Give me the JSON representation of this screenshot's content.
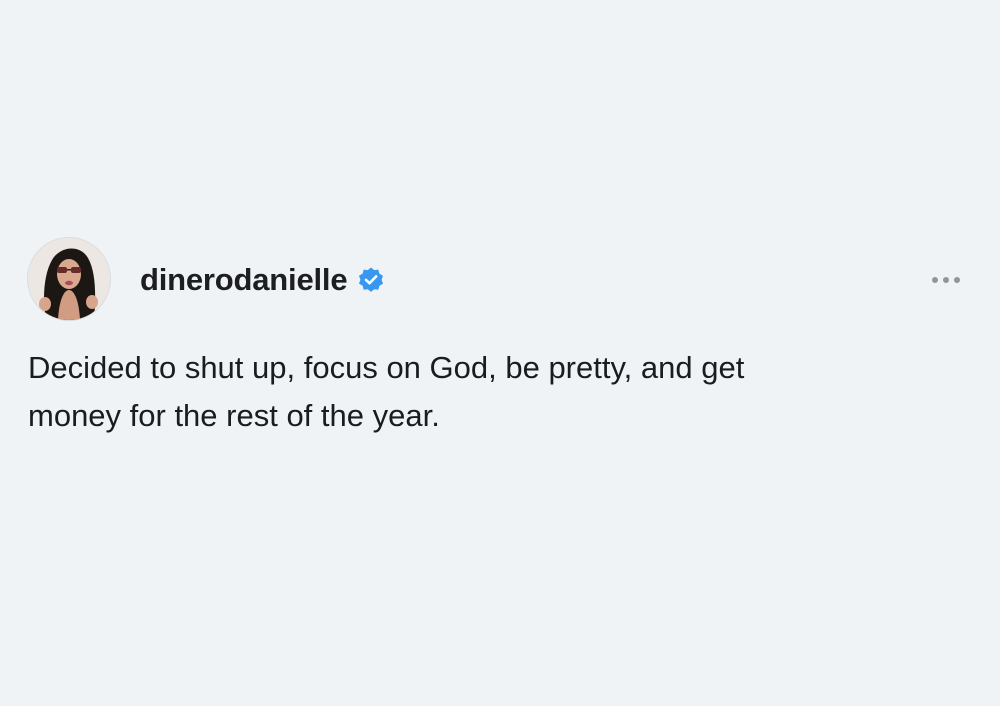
{
  "post": {
    "username": "dinerodanielle",
    "verified_icon": "verified-badge-icon",
    "more_icon": "more-options-icon",
    "text_lines": [
      "Decided to shut up, focus on God, be pretty, and get",
      "money for the rest of the year."
    ]
  },
  "colors": {
    "background": "#f0f3f5",
    "verified_blue": "#3897f0",
    "text": "#1a1c1f",
    "muted": "#8e959b"
  }
}
